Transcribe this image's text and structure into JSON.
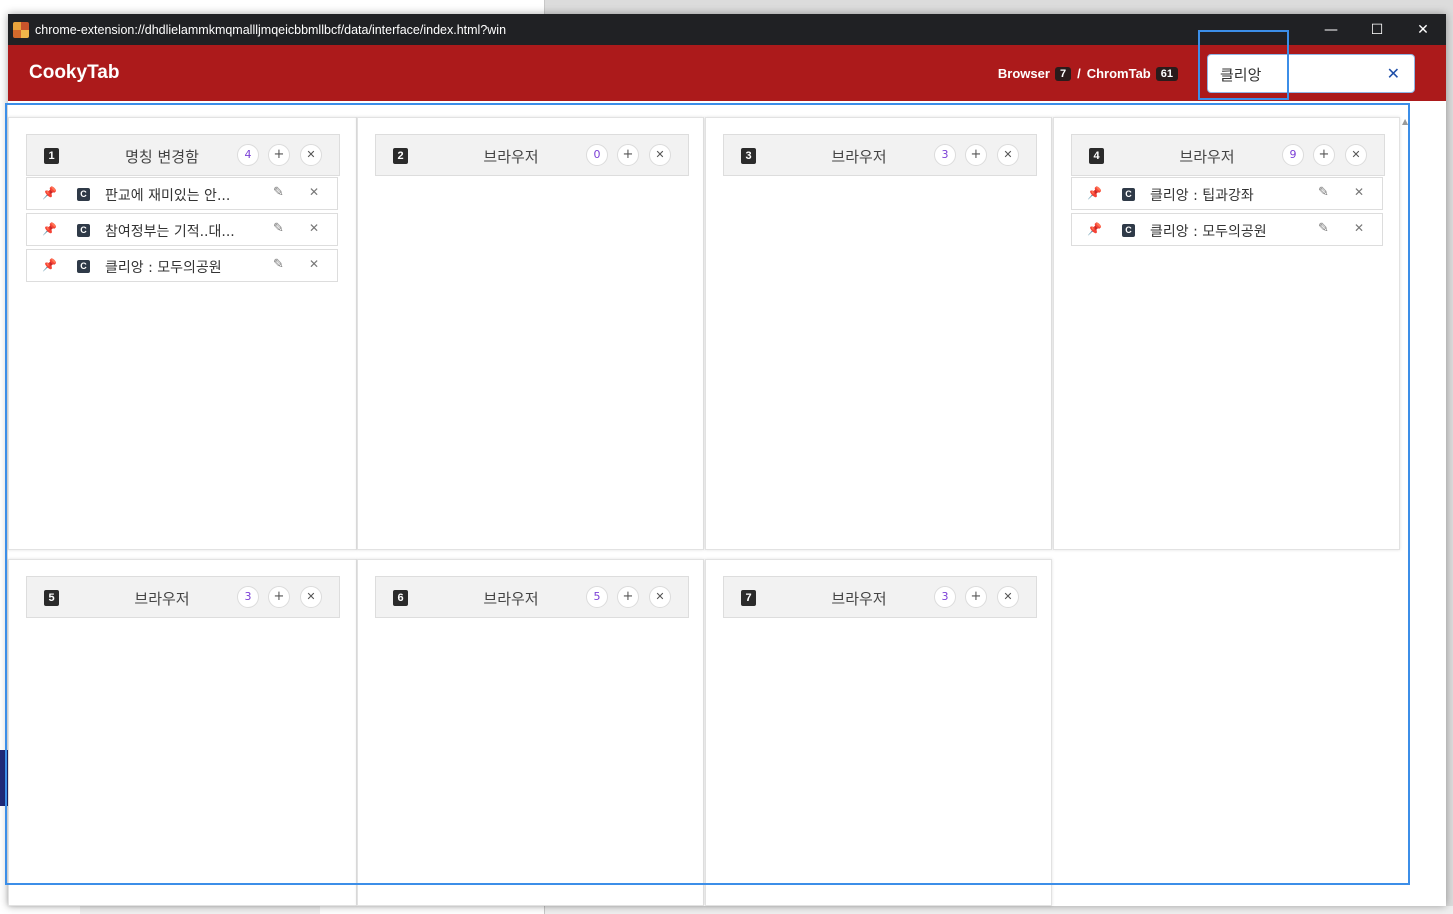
{
  "window": {
    "url": "chrome-extension://dhdlielammkmqmallljmqeicbbmllbcf/data/interface/index.html?win",
    "controls": {
      "minimize": "—",
      "maximize": "☐",
      "close": "✕"
    }
  },
  "header": {
    "brand": "CookyTab",
    "browser_label": "Browser",
    "browser_count": "7",
    "separator": "/",
    "tab_label": "ChromTab",
    "tab_count": "61"
  },
  "search": {
    "value": "클리앙",
    "clear_glyph": "✕"
  },
  "panels": [
    {
      "number": "1",
      "title": "명칭 변경함",
      "count": "4",
      "tabs": [
        {
          "title": "판교에 재미있는 안..."
        },
        {
          "title": "참여정부는 기적..대..."
        },
        {
          "title": "클리앙 : 모두의공원"
        }
      ]
    },
    {
      "number": "2",
      "title": "브라우저",
      "count": "0",
      "tabs": []
    },
    {
      "number": "3",
      "title": "브라우저",
      "count": "3",
      "tabs": []
    },
    {
      "number": "4",
      "title": "브라우저",
      "count": "9",
      "tabs": [
        {
          "title": "클리앙 : 팁과강좌"
        },
        {
          "title": "클리앙 : 모두의공원"
        }
      ]
    },
    {
      "number": "5",
      "title": "브라우저",
      "count": "3",
      "tabs": []
    },
    {
      "number": "6",
      "title": "브라우저",
      "count": "5",
      "tabs": []
    },
    {
      "number": "7",
      "title": "브라우저",
      "count": "3",
      "tabs": []
    }
  ],
  "icons": {
    "add": "+",
    "close": "✕",
    "pin": "📌",
    "edit": "✎",
    "favicon": "C"
  },
  "colors": {
    "header": "#ac1a1b",
    "titlebar": "#202124",
    "count_accent": "#7b3fd6",
    "highlight": "#3c8ee8"
  }
}
